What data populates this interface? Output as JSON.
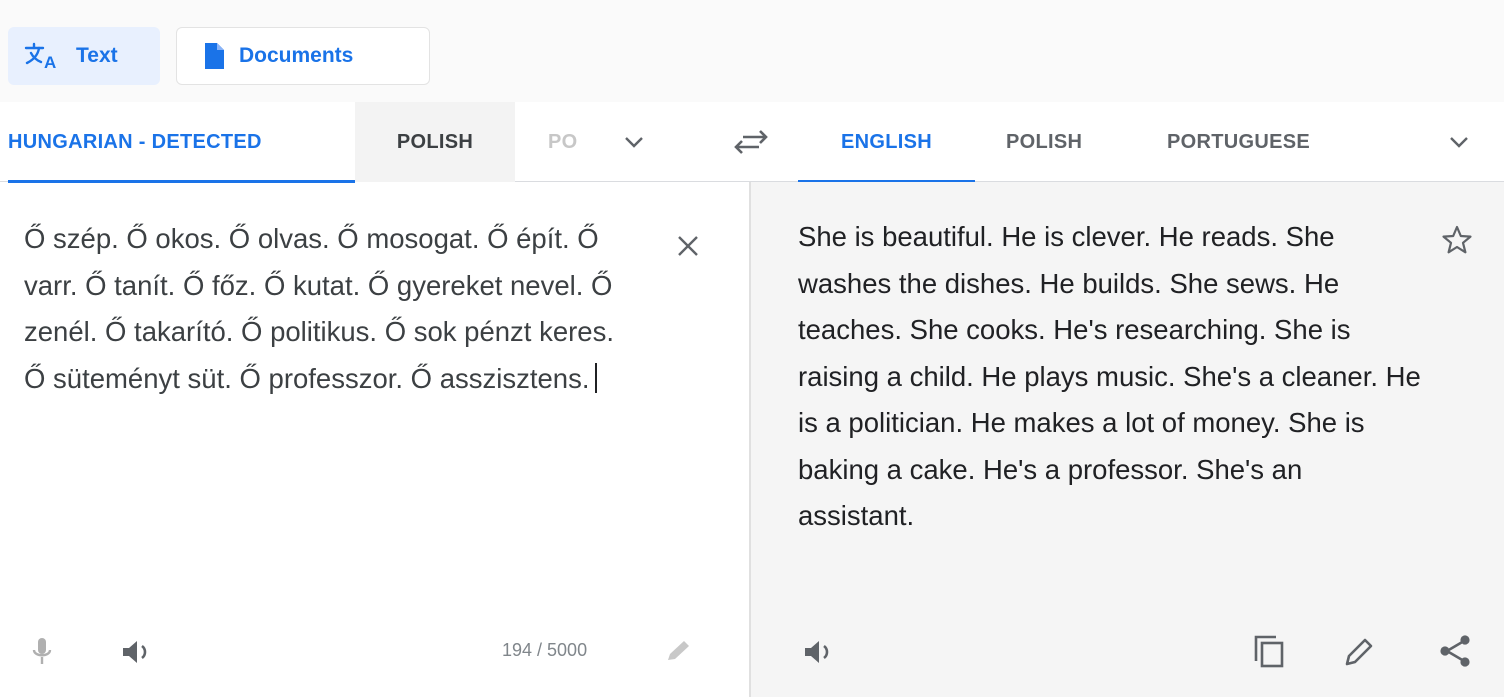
{
  "modes": {
    "text_label": "Text",
    "documents_label": "Documents"
  },
  "source_tabs": {
    "detected": "HUNGARIAN - DETECTED",
    "polish": "POLISH",
    "truncated": "PO"
  },
  "target_tabs": {
    "english": "ENGLISH",
    "polish": "POLISH",
    "portuguese": "PORTUGUESE"
  },
  "source": {
    "text": "Ő szép. Ő okos. Ő olvas. Ő mosogat. Ő épít. Ő varr. Ő tanít. Ő főz. Ő kutat. Ő gyereket nevel. Ő zenél. Ő takarító. Ő politikus. Ő sok pénzt keres. Ő süteményt süt. Ő professzor. Ő asszisztens.",
    "char_count": "194 / 5000"
  },
  "target": {
    "text": "She is beautiful. He is clever. He reads. She washes the dishes. He builds. She sews. He teaches. She cooks. He's researching. She is raising a child. He plays music. She's a cleaner. He is a politician. He makes a lot of money. She is baking a cake. He's a professor. She's an assistant."
  },
  "icons": [
    "translate-icon",
    "document-icon",
    "chevron-down-icon",
    "swap-icon",
    "close-icon",
    "star-icon",
    "microphone-icon",
    "speaker-icon",
    "pencil-icon",
    "copy-icon",
    "share-icon"
  ],
  "colors": {
    "accent": "#1a73e8",
    "tab_active_bg": "#e8f0fe",
    "target_bg": "#f5f5f5",
    "icon_gray": "#5f6368"
  }
}
